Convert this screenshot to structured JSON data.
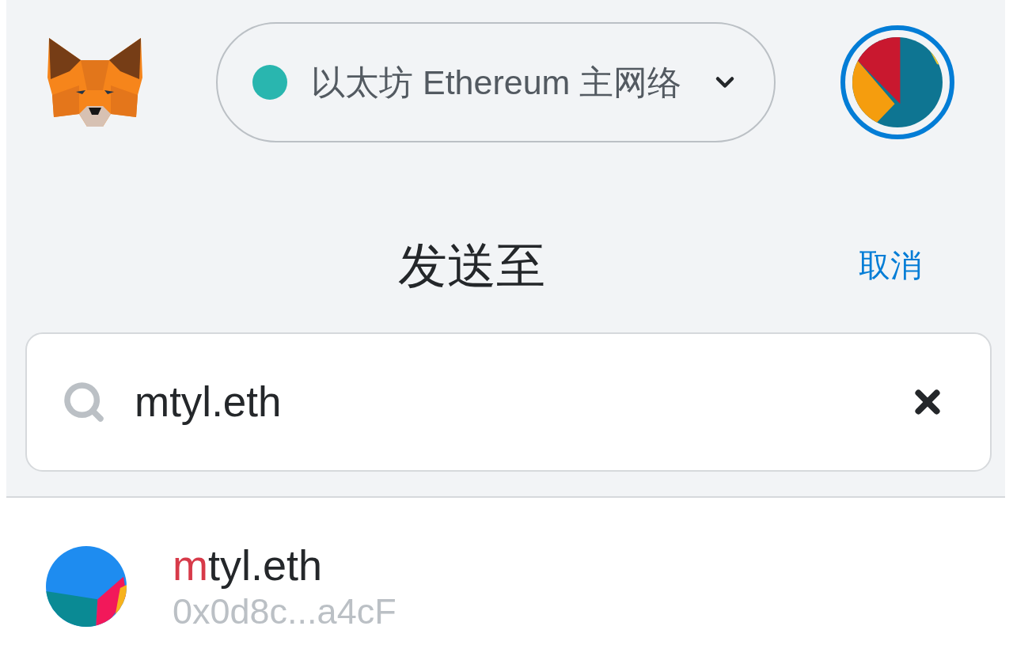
{
  "header": {
    "network": {
      "label": "以太坊 Ethereum 主网络"
    }
  },
  "page": {
    "title": "发送至",
    "cancel": "取消"
  },
  "search": {
    "value": "mtyl.eth"
  },
  "results": [
    {
      "name_match": "m",
      "name_rest": "tyl.eth",
      "address": "0x0d8c...a4cF"
    }
  ]
}
